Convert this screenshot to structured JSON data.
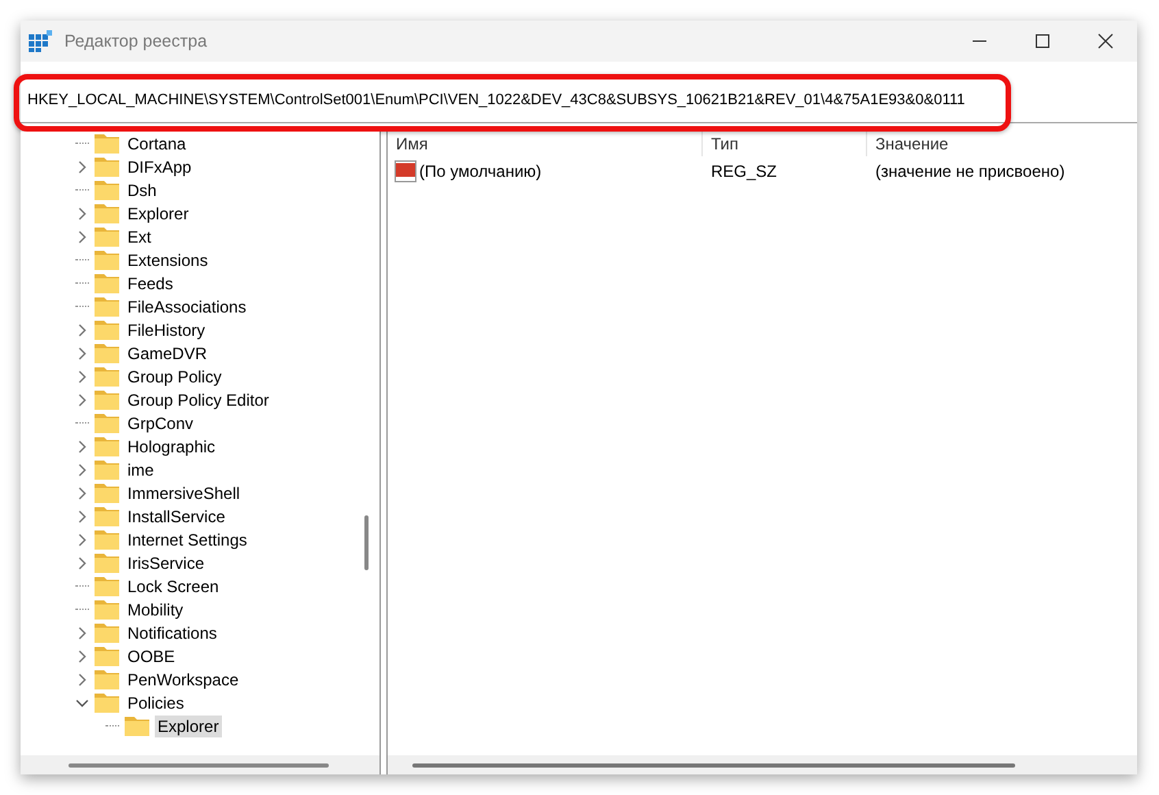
{
  "window": {
    "title": "Редактор реестра"
  },
  "address": "HKEY_LOCAL_MACHINE\\SYSTEM\\ControlSet001\\Enum\\PCI\\VEN_1022&DEV_43C8&SUBSYS_10621B21&REV_01\\4&75A1E93&0&0111",
  "tree": [
    {
      "name": "Cortana",
      "selected": false
    },
    {
      "name": "DIFxApp",
      "expanded": false,
      "selected": false
    },
    {
      "name": "Dsh",
      "selected": false
    },
    {
      "name": "Explorer",
      "expanded": false,
      "selected": false
    },
    {
      "name": "Ext",
      "expanded": false,
      "selected": false
    },
    {
      "name": "Extensions",
      "selected": false
    },
    {
      "name": "Feeds",
      "selected": false
    },
    {
      "name": "FileAssociations",
      "selected": false
    },
    {
      "name": "FileHistory",
      "expanded": false,
      "selected": false
    },
    {
      "name": "GameDVR",
      "expanded": false,
      "selected": false
    },
    {
      "name": "Group Policy",
      "expanded": false,
      "selected": false
    },
    {
      "name": "Group Policy Editor",
      "expanded": false,
      "selected": false
    },
    {
      "name": "GrpConv",
      "selected": false
    },
    {
      "name": "Holographic",
      "expanded": false,
      "selected": false
    },
    {
      "name": "ime",
      "expanded": false,
      "selected": false
    },
    {
      "name": "ImmersiveShell",
      "expanded": false,
      "selected": false
    },
    {
      "name": "InstallService",
      "expanded": false,
      "selected": false
    },
    {
      "name": "Internet Settings",
      "expanded": false,
      "selected": false
    },
    {
      "name": "IrisService",
      "expanded": false,
      "selected": false
    },
    {
      "name": "Lock Screen",
      "selected": false
    },
    {
      "name": "Mobility",
      "selected": false
    },
    {
      "name": "Notifications",
      "expanded": false,
      "selected": false
    },
    {
      "name": "OOBE",
      "expanded": false,
      "selected": false
    },
    {
      "name": "PenWorkspace",
      "expanded": false,
      "selected": false
    },
    {
      "name": "Policies",
      "expanded": true,
      "selected": false,
      "children": [
        {
          "name": "Explorer",
          "selected": true
        }
      ]
    }
  ],
  "columns": [
    "Имя",
    "Тип",
    "Значение"
  ],
  "values": [
    {
      "name": "(По умолчанию)",
      "type": "REG_SZ",
      "data": "(значение не присвоено)"
    }
  ]
}
